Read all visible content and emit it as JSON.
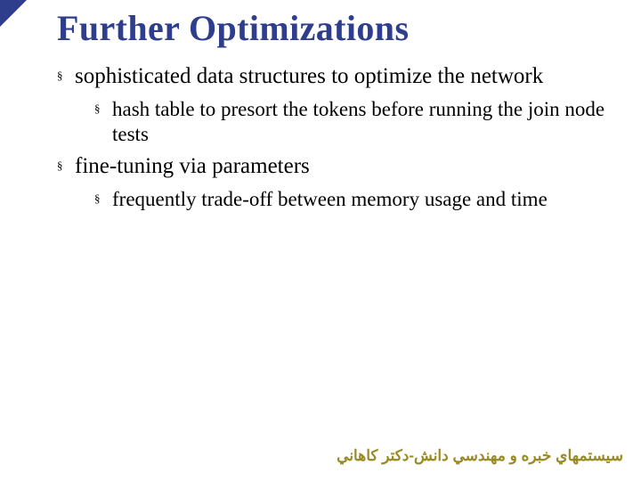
{
  "title": "Further Optimizations",
  "bullets": [
    {
      "text": "sophisticated data structures to optimize the network",
      "children": [
        {
          "text": "hash table to presort the tokens before running the join node tests"
        }
      ]
    },
    {
      "text": "fine-tuning via parameters",
      "children": [
        {
          "text": "frequently trade-off between memory usage and time"
        }
      ]
    }
  ],
  "footer": "سيستمهاي خبره و مهندسي دانش-دكتر كاهاني"
}
